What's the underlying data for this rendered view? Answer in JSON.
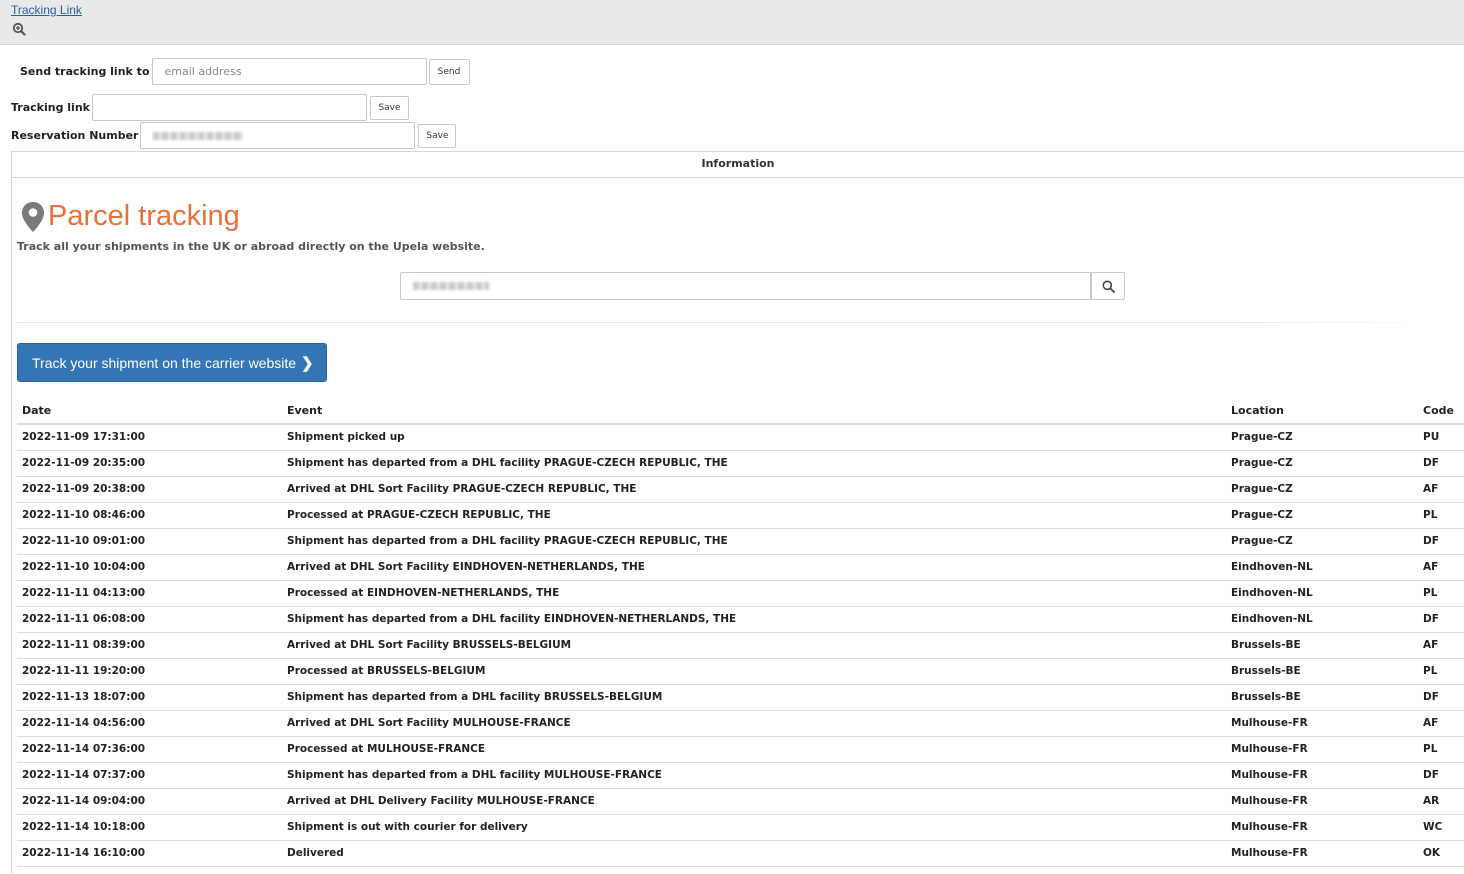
{
  "topbar": {
    "link_label": "Tracking Link"
  },
  "send": {
    "label": "Send tracking link to",
    "placeholder": "email address",
    "button": "Send"
  },
  "tracking": {
    "label": "Tracking link",
    "value": "",
    "button": "Save"
  },
  "reservation": {
    "label": "Reservation Number",
    "button": "Save"
  },
  "panel": {
    "heading": "Information"
  },
  "parcel": {
    "title": "Parcel tracking",
    "subtitle": "Track all your shipments in the UK or abroad directly on the Upela website.",
    "carrier_button": "Track your shipment on the carrier website",
    "title_color": "#e8703a",
    "button_color": "#3475b5"
  },
  "table": {
    "headers": [
      "Date",
      "Event",
      "Location",
      "Code"
    ],
    "rows": [
      [
        "2022-11-09 17:31:00",
        "Shipment picked up",
        "Prague-CZ",
        "PU"
      ],
      [
        "2022-11-09 20:35:00",
        "Shipment has departed from a DHL facility PRAGUE-CZECH REPUBLIC, THE",
        "Prague-CZ",
        "DF"
      ],
      [
        "2022-11-09 20:38:00",
        "Arrived at DHL Sort Facility PRAGUE-CZECH REPUBLIC, THE",
        "Prague-CZ",
        "AF"
      ],
      [
        "2022-11-10 08:46:00",
        "Processed at PRAGUE-CZECH REPUBLIC, THE",
        "Prague-CZ",
        "PL"
      ],
      [
        "2022-11-10 09:01:00",
        "Shipment has departed from a DHL facility PRAGUE-CZECH REPUBLIC, THE",
        "Prague-CZ",
        "DF"
      ],
      [
        "2022-11-10 10:04:00",
        "Arrived at DHL Sort Facility EINDHOVEN-NETHERLANDS, THE",
        "Eindhoven-NL",
        "AF"
      ],
      [
        "2022-11-11 04:13:00",
        "Processed at EINDHOVEN-NETHERLANDS, THE",
        "Eindhoven-NL",
        "PL"
      ],
      [
        "2022-11-11 06:08:00",
        "Shipment has departed from a DHL facility EINDHOVEN-NETHERLANDS, THE",
        "Eindhoven-NL",
        "DF"
      ],
      [
        "2022-11-11 08:39:00",
        "Arrived at DHL Sort Facility BRUSSELS-BELGIUM",
        "Brussels-BE",
        "AF"
      ],
      [
        "2022-11-11 19:20:00",
        "Processed at BRUSSELS-BELGIUM",
        "Brussels-BE",
        "PL"
      ],
      [
        "2022-11-13 18:07:00",
        "Shipment has departed from a DHL facility BRUSSELS-BELGIUM",
        "Brussels-BE",
        "DF"
      ],
      [
        "2022-11-14 04:56:00",
        "Arrived at DHL Sort Facility MULHOUSE-FRANCE",
        "Mulhouse-FR",
        "AF"
      ],
      [
        "2022-11-14 07:36:00",
        "Processed at MULHOUSE-FRANCE",
        "Mulhouse-FR",
        "PL"
      ],
      [
        "2022-11-14 07:37:00",
        "Shipment has departed from a DHL facility MULHOUSE-FRANCE",
        "Mulhouse-FR",
        "DF"
      ],
      [
        "2022-11-14 09:04:00",
        "Arrived at DHL Delivery Facility MULHOUSE-FRANCE",
        "Mulhouse-FR",
        "AR"
      ],
      [
        "2022-11-14 10:18:00",
        "Shipment is out with courier for delivery",
        "Mulhouse-FR",
        "WC"
      ],
      [
        "2022-11-14 16:10:00",
        "Delivered",
        "Mulhouse-FR",
        "OK"
      ]
    ]
  }
}
